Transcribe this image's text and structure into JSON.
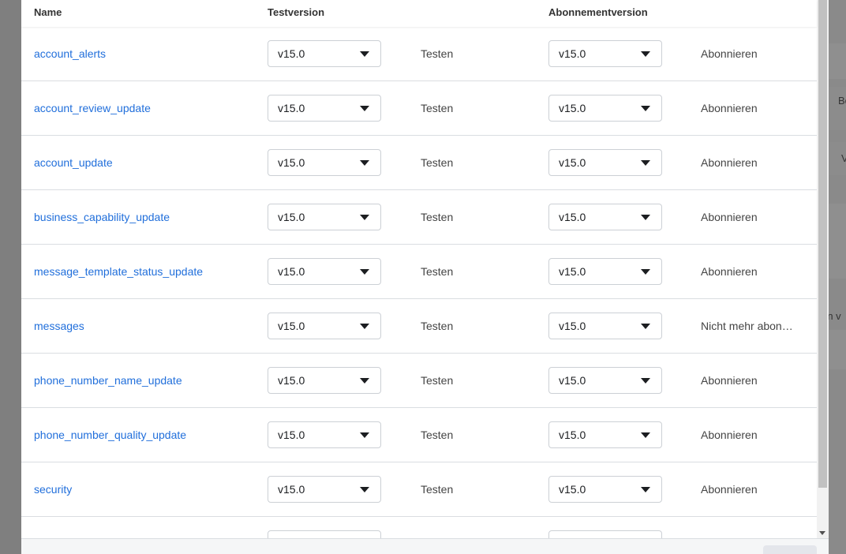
{
  "background": {
    "texts": [
      "Bo",
      "V",
      "rn v"
    ]
  },
  "table": {
    "headers": {
      "name": "Name",
      "test_version": "Testversion",
      "subscription_version": "Abonnementversion"
    },
    "rows": [
      {
        "name": "account_alerts",
        "test_version": "v15.0",
        "test_action": "Testen",
        "subscription_version": "v15.0",
        "subscription_action": "Abonnieren"
      },
      {
        "name": "account_review_update",
        "test_version": "v15.0",
        "test_action": "Testen",
        "subscription_version": "v15.0",
        "subscription_action": "Abonnieren"
      },
      {
        "name": "account_update",
        "test_version": "v15.0",
        "test_action": "Testen",
        "subscription_version": "v15.0",
        "subscription_action": "Abonnieren"
      },
      {
        "name": "business_capability_update",
        "test_version": "v15.0",
        "test_action": "Testen",
        "subscription_version": "v15.0",
        "subscription_action": "Abonnieren"
      },
      {
        "name": "message_template_status_update",
        "test_version": "v15.0",
        "test_action": "Testen",
        "subscription_version": "v15.0",
        "subscription_action": "Abonnieren"
      },
      {
        "name": "messages",
        "test_version": "v15.0",
        "test_action": "Testen",
        "subscription_version": "v15.0",
        "subscription_action": "Nicht mehr abon…"
      },
      {
        "name": "phone_number_name_update",
        "test_version": "v15.0",
        "test_action": "Testen",
        "subscription_version": "v15.0",
        "subscription_action": "Abonnieren"
      },
      {
        "name": "phone_number_quality_update",
        "test_version": "v15.0",
        "test_action": "Testen",
        "subscription_version": "v15.0",
        "subscription_action": "Abonnieren"
      },
      {
        "name": "security",
        "test_version": "v15.0",
        "test_action": "Testen",
        "subscription_version": "v15.0",
        "subscription_action": "Abonnieren"
      },
      {
        "name": "",
        "test_version": "",
        "test_action": "",
        "subscription_version": "",
        "subscription_action": ""
      }
    ]
  },
  "icons": {
    "dropdown": "caret-down-icon",
    "scroll_down": "scroll-down-arrow-icon"
  },
  "colors": {
    "link": "#216fdb",
    "overlay": "#7f7f7f"
  }
}
